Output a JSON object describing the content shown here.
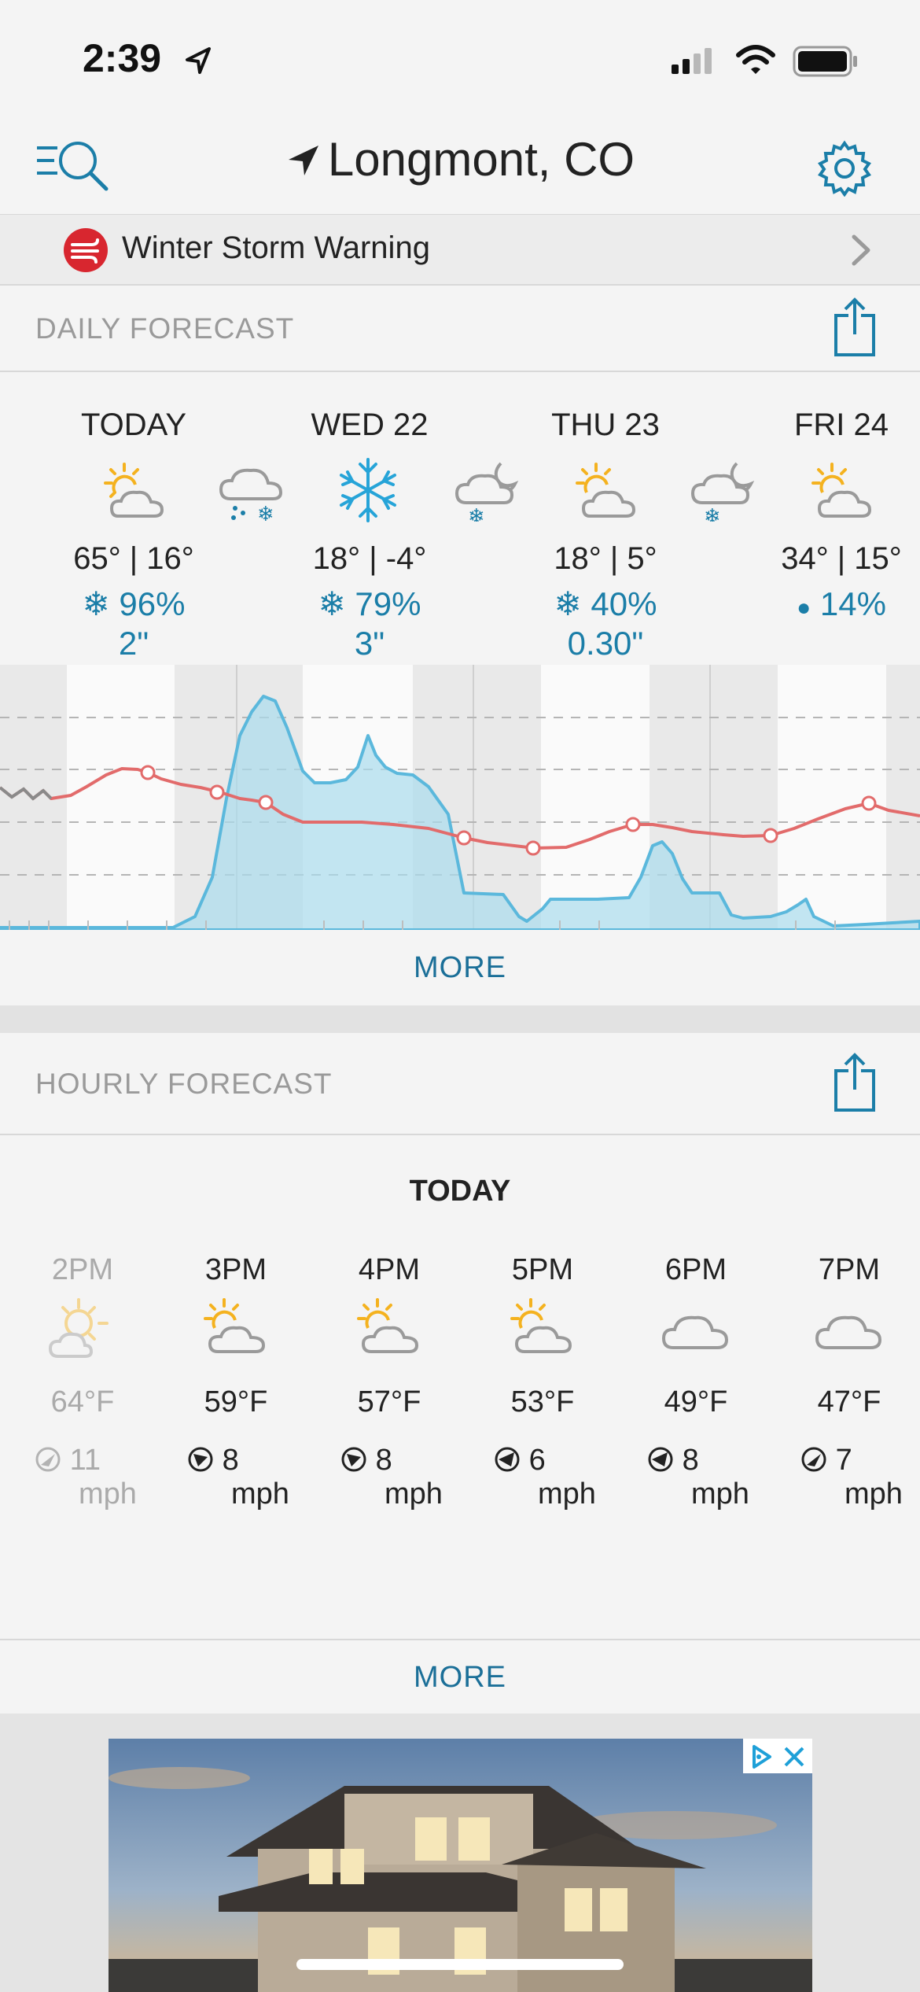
{
  "status": {
    "time": "2:39"
  },
  "nav": {
    "location": "Longmont, CO"
  },
  "alert": {
    "text": "Winter Storm Warning"
  },
  "daily": {
    "title": "DAILY FORECAST",
    "more_label": "MORE",
    "days": [
      {
        "label": "TODAY",
        "temps": "65° | 16°",
        "precip_pct": "96%",
        "precip_amt": "2\"",
        "precip_type": "snow"
      },
      {
        "label": "WED 22",
        "temps": "18° | -4°",
        "precip_pct": "79%",
        "precip_amt": "3\"",
        "precip_type": "snow"
      },
      {
        "label": "THU 23",
        "temps": "18° | 5°",
        "precip_pct": "40%",
        "precip_amt": "0.30\"",
        "precip_type": "snow"
      },
      {
        "label": "FRI 24",
        "temps": "34° | 15°",
        "precip_pct": "14%",
        "precip_amt": "",
        "precip_type": "rain"
      }
    ]
  },
  "hourly": {
    "title": "HOURLY FORECAST",
    "day_label": "TODAY",
    "more_label": "MORE",
    "hours": [
      {
        "time": "2PM",
        "temp": "64°F",
        "wind_speed": "11",
        "wind_unit": "mph",
        "icon": "partly-cloudy-icon",
        "past": true
      },
      {
        "time": "3PM",
        "temp": "59°F",
        "wind_speed": "8",
        "wind_unit": "mph",
        "icon": "partly-cloudy-icon",
        "past": false
      },
      {
        "time": "4PM",
        "temp": "57°F",
        "wind_speed": "8",
        "wind_unit": "mph",
        "icon": "partly-cloudy-icon",
        "past": false
      },
      {
        "time": "5PM",
        "temp": "53°F",
        "wind_speed": "6",
        "wind_unit": "mph",
        "icon": "partly-cloudy-icon",
        "past": false
      },
      {
        "time": "6PM",
        "temp": "49°F",
        "wind_speed": "8",
        "wind_unit": "mph",
        "icon": "cloud-icon",
        "past": false
      },
      {
        "time": "7PM",
        "temp": "47°F",
        "wind_speed": "7",
        "wind_unit": "mph",
        "icon": "cloud-icon",
        "past": false
      }
    ]
  },
  "colors": {
    "accent": "#1b7ea8",
    "alert": "#d8262f",
    "temp_line": "#e26b6b",
    "precip_fill": "#a9dbec",
    "precip_line": "#5bb8dc",
    "sun": "#f4b21f"
  }
}
